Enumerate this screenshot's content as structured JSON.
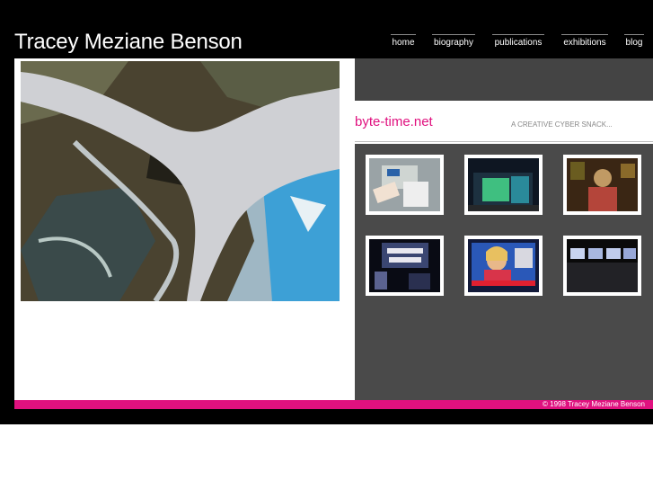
{
  "site": {
    "title": "Tracey Meziane Benson"
  },
  "nav": {
    "items": [
      {
        "label": "home"
      },
      {
        "label": "biography"
      },
      {
        "label": "publications"
      },
      {
        "label": "exhibitions"
      },
      {
        "label": "blog"
      }
    ]
  },
  "hero": {
    "image_name": "satellite-aerial-river-delta-image"
  },
  "feature": {
    "title": "byte-time.net",
    "tagline": "A CREATIVE CYBER SNACK..."
  },
  "gallery": {
    "thumbnails": [
      {
        "name": "thumb-card-reader"
      },
      {
        "name": "thumb-bus-shelter"
      },
      {
        "name": "thumb-figure-portrait"
      },
      {
        "name": "thumb-air-raid-shelter"
      },
      {
        "name": "thumb-tv-news"
      },
      {
        "name": "thumb-exhibition-screens"
      }
    ]
  },
  "footer": {
    "copyright": "© 1998 Tracey Meziane Benson"
  },
  "colors": {
    "accent": "#e0117f",
    "background": "#000000",
    "panel_dark": "#4a4a4a"
  }
}
